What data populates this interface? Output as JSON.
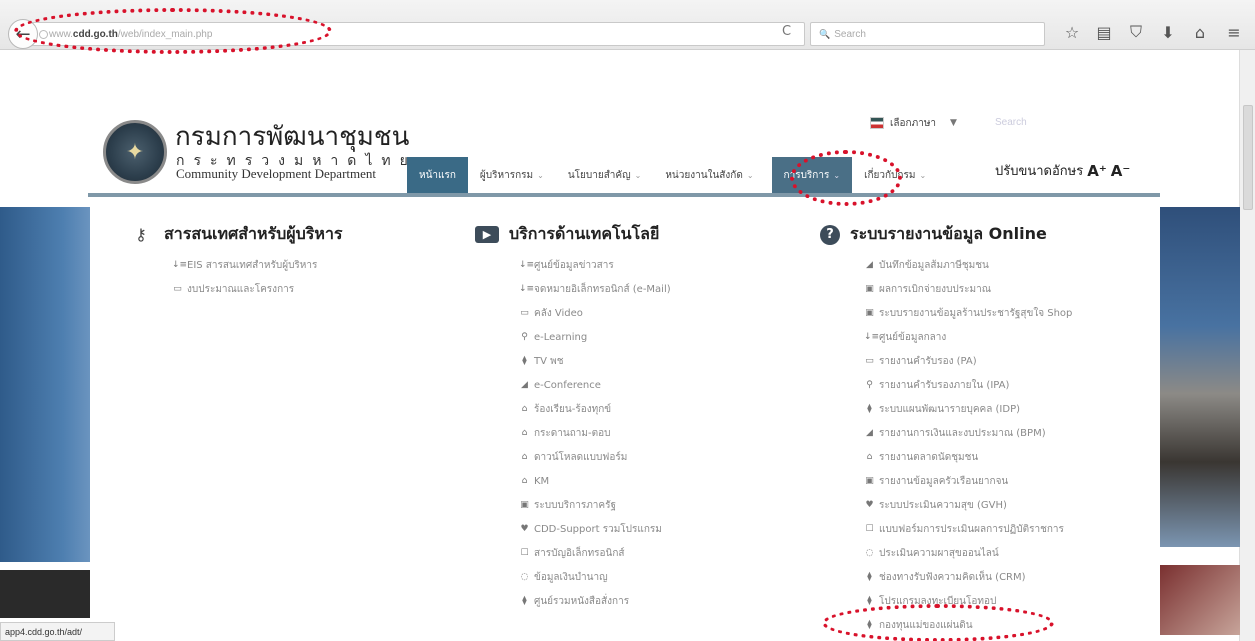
{
  "browser": {
    "back_icon": "←",
    "url_scheme": "www.",
    "url_domain": "cdd.go.th",
    "url_path": "/web/index_main.php",
    "reload_icon": "C",
    "search_placeholder": "Search",
    "search_icon": "🔍",
    "toolbar_icons": [
      "☆",
      "▤",
      "⛉",
      "⬇",
      "⌂",
      "≡"
    ]
  },
  "site": {
    "title_th": "กรมการพัฒนาชุมชน",
    "ministry_th": "กระทรวงมหาดไทย",
    "title_en": "Community Development Department",
    "language_label": "เลือกภาษา",
    "language_caret": "▼",
    "search_placeholder": "Search",
    "font_size_label": "ปรับขนาดอักษร",
    "font_increase": "A⁺",
    "font_decrease": "A⁻"
  },
  "nav": [
    {
      "label": "หน้าแรก",
      "caret": ""
    },
    {
      "label": "ผู้บริหารกรม",
      "caret": "⌄"
    },
    {
      "label": "นโยบายสำคัญ",
      "caret": "⌄"
    },
    {
      "label": "หน่วยงานในสังกัด",
      "caret": "⌄"
    },
    {
      "label": "การบริการ",
      "caret": "⌄"
    },
    {
      "label": "เกี่ยวกับกรม",
      "caret": "⌄"
    }
  ],
  "menu": {
    "col1": {
      "title": "สารสนเทศสำหรับผู้บริหาร",
      "items": [
        {
          "icon": "↓≡",
          "label": "EIS สารสนเทศสำหรับผู้บริหาร"
        },
        {
          "icon": "▭",
          "label": "งบประมาณและโครงการ"
        }
      ]
    },
    "col2": {
      "title": "บริการด้านเทคโนโลยี",
      "items": [
        {
          "icon": "↓≡",
          "label": "ศูนย์ข้อมูลข่าวสาร"
        },
        {
          "icon": "↓≡",
          "label": "จดหมายอิเล็กทรอนิกส์ (e-Mail)"
        },
        {
          "icon": "▭",
          "label": "คลัง Video"
        },
        {
          "icon": "⚲",
          "label": "e-Learning"
        },
        {
          "icon": "⧫",
          "label": "TV พช"
        },
        {
          "icon": "◢",
          "label": "e-Conference"
        },
        {
          "icon": "⌂",
          "label": "ร้องเรียน-ร้องทุกข์"
        },
        {
          "icon": "⌂",
          "label": "กระดานถาม-ตอบ"
        },
        {
          "icon": "⌂",
          "label": "ดาวน์โหลดแบบฟอร์ม"
        },
        {
          "icon": "⌂",
          "label": "KM"
        },
        {
          "icon": "▣",
          "label": "ระบบบริการภาครัฐ"
        },
        {
          "icon": "♥",
          "label": "CDD-Support รวมโปรแกรม"
        },
        {
          "icon": "☐",
          "label": "สารบัญอิเล็กทรอนิกส์"
        },
        {
          "icon": "◌",
          "label": "ข้อมูลเงินบำนาญ"
        },
        {
          "icon": "⧫",
          "label": "ศูนย์รวมหนังสือสั่งการ"
        }
      ]
    },
    "col3": {
      "title": "ระบบรายงานข้อมูล Online",
      "items": [
        {
          "icon": "◢",
          "label": "บันทึกข้อมูลส้มภาษีชุมชน"
        },
        {
          "icon": "▣",
          "label": "ผลการเบิกจ่ายงบประมาณ"
        },
        {
          "icon": "▣",
          "label": "ระบบรายงานข้อมูลร้านประชารัฐสุขใจ Shop"
        },
        {
          "icon": "↓≡",
          "label": "ศูนย์ข้อมูลกลาง"
        },
        {
          "icon": "▭",
          "label": "รายงานคำรับรอง (PA)"
        },
        {
          "icon": "⚲",
          "label": "รายงานคำรับรองภายใน (IPA)"
        },
        {
          "icon": "⧫",
          "label": "ระบบแผนพัฒนารายบุคคล (IDP)"
        },
        {
          "icon": "◢",
          "label": "รายงานการเงินและงบประมาณ (BPM)"
        },
        {
          "icon": "⌂",
          "label": "รายงานตลาดนัดชุมชน"
        },
        {
          "icon": "▣",
          "label": "รายงานข้อมูลครัวเรือนยากจน"
        },
        {
          "icon": "♥",
          "label": "ระบบประเมินความสุข (GVH)"
        },
        {
          "icon": "☐",
          "label": "แบบฟอร์มการประเมินผลการปฏิบัติราชการ"
        },
        {
          "icon": "◌",
          "label": "ประเมินความผาสุขออนไลน์"
        },
        {
          "icon": "⧫",
          "label": "ช่องทางรับฟังความคิดเห็น (CRM)"
        },
        {
          "icon": "⧫",
          "label": "โปรแกรมลงทะเบียนโอทอป"
        },
        {
          "icon": "⧫",
          "label": "กองทุนแม่ของแผ่นดิน"
        }
      ]
    }
  },
  "status_bar": "app4.cdd.go.th/adt/",
  "colors": {
    "highlight": "#d8122b",
    "nav_active": "#3a6a86"
  }
}
